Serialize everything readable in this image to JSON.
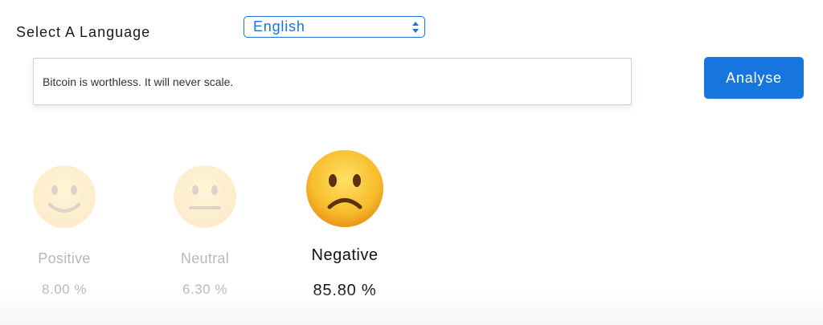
{
  "language_selector": {
    "label": "Select A Language",
    "selected": "English"
  },
  "input": {
    "value": "Bitcoin is worthless. It will never scale."
  },
  "analyse_button": {
    "label": "Analyse"
  },
  "results": [
    {
      "label": "Positive",
      "percent": "8.00 %",
      "icon": "smiling-face-icon",
      "active": false
    },
    {
      "label": "Neutral",
      "percent": "6.30 %",
      "icon": "neutral-face-icon",
      "active": false
    },
    {
      "label": "Negative",
      "percent": "85.80 %",
      "icon": "frowning-face-icon",
      "active": true
    }
  ],
  "colors": {
    "accent": "#1676dd",
    "emoji_face": "#f5b82e",
    "inactive_text": "#b8b8b8"
  }
}
